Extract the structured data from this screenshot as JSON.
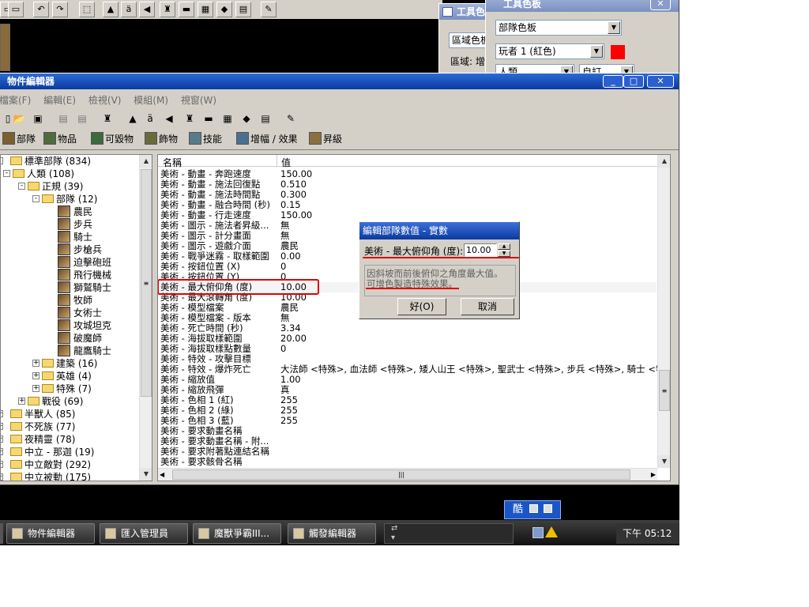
{
  "editor_window": {
    "title": "物件編輯器",
    "menu": [
      "檔案(F)",
      "編輯(E)",
      "檢視(V)",
      "模組(M)",
      "視窗(W)"
    ],
    "tabs": [
      {
        "label": "部隊",
        "icon": "unit-icon"
      },
      {
        "label": "物品",
        "icon": "item-icon"
      },
      {
        "label": "可毀物",
        "icon": "destructible-icon"
      },
      {
        "label": "飾物",
        "icon": "doodad-icon"
      },
      {
        "label": "技能",
        "icon": "ability-icon"
      },
      {
        "label": "增幅 / 效果",
        "icon": "buff-icon"
      },
      {
        "label": "昇級",
        "icon": "upgrade-icon"
      }
    ]
  },
  "tree": [
    {
      "label": "標準部隊 (834)",
      "kind": "folder",
      "depth": 0,
      "expander": "-"
    },
    {
      "label": "人類 (108)",
      "kind": "folder",
      "depth": 1,
      "expander": "-"
    },
    {
      "label": "正規 (39)",
      "kind": "folder",
      "depth": 2,
      "expander": "-"
    },
    {
      "label": "部隊 (12)",
      "kind": "folder",
      "depth": 3,
      "expander": "-"
    },
    {
      "label": "農民",
      "kind": "unit",
      "depth": 4
    },
    {
      "label": "步兵",
      "kind": "unit",
      "depth": 4
    },
    {
      "label": "騎士",
      "kind": "unit",
      "depth": 4
    },
    {
      "label": "步槍兵",
      "kind": "unit",
      "depth": 4
    },
    {
      "label": "迫擊砲班",
      "kind": "unit",
      "depth": 4
    },
    {
      "label": "飛行機械",
      "kind": "unit",
      "depth": 4
    },
    {
      "label": "獅鷲騎士",
      "kind": "unit",
      "depth": 4
    },
    {
      "label": "牧師",
      "kind": "unit",
      "depth": 4
    },
    {
      "label": "女術士",
      "kind": "unit",
      "depth": 4
    },
    {
      "label": "攻城坦克",
      "kind": "unit",
      "depth": 4
    },
    {
      "label": "破魔師",
      "kind": "unit",
      "depth": 4
    },
    {
      "label": "龍鷹騎士",
      "kind": "unit",
      "depth": 4
    },
    {
      "label": "建築 (16)",
      "kind": "folder",
      "depth": 3,
      "expander": "+"
    },
    {
      "label": "英雄 (4)",
      "kind": "folder",
      "depth": 3,
      "expander": "+"
    },
    {
      "label": "特殊 (7)",
      "kind": "folder",
      "depth": 3,
      "expander": "+"
    },
    {
      "label": "戰役 (69)",
      "kind": "folder",
      "depth": 2,
      "expander": "+"
    },
    {
      "label": "半獸人 (85)",
      "kind": "folder",
      "depth": 0,
      "expander": "+"
    },
    {
      "label": "不死族 (77)",
      "kind": "folder",
      "depth": 0,
      "expander": "+"
    },
    {
      "label": "夜精靈 (78)",
      "kind": "folder",
      "depth": 0,
      "expander": "+"
    },
    {
      "label": "中立 - 那迦 (19)",
      "kind": "folder",
      "depth": 0,
      "expander": "+"
    },
    {
      "label": "中立敵對 (292)",
      "kind": "folder",
      "depth": 0,
      "expander": "+"
    },
    {
      "label": "中立被動 (175)",
      "kind": "folder",
      "depth": 0,
      "expander": "+"
    }
  ],
  "grid": {
    "header_name": "名稱",
    "header_value": "值",
    "rows": [
      {
        "name": "美術 - 動畫 - 奔跑速度",
        "value": "150.00"
      },
      {
        "name": "美術 - 動畫 - 施法回復點",
        "value": "0.510"
      },
      {
        "name": "美術 - 動畫 - 施法時間點",
        "value": "0.300"
      },
      {
        "name": "美術 - 動畫 - 融合時間 (秒)",
        "value": "0.15"
      },
      {
        "name": "美術 - 動畫 - 行走速度",
        "value": "150.00"
      },
      {
        "name": "美術 - 圖示 - 施法者昇級...",
        "value": "無"
      },
      {
        "name": "美術 - 圖示 - 計分畫面",
        "value": "無"
      },
      {
        "name": "美術 - 圖示 - 遊戲介面",
        "value": "農民"
      },
      {
        "name": "美術 - 戰爭迷霧 - 取樣範圍",
        "value": "0.00"
      },
      {
        "name": "美術 - 按鈕位置 (X)",
        "value": "0"
      },
      {
        "name": "美術 - 按鈕位置 (Y)",
        "value": "0"
      },
      {
        "name": "美術 - 最大俯仰角 (度)",
        "value": "10.00",
        "selected": true
      },
      {
        "name": "美術 - 最大滾轉角 (度)",
        "value": "10.00"
      },
      {
        "name": "美術 - 模型檔案",
        "value": "農民"
      },
      {
        "name": "美術 - 模型檔案 - 版本",
        "value": "無"
      },
      {
        "name": "美術 - 死亡時間 (秒)",
        "value": "3.34"
      },
      {
        "name": "美術 - 海拔取樣範圍",
        "value": "20.00"
      },
      {
        "name": "美術 - 海拔取樣點數量",
        "value": "0"
      },
      {
        "name": "美術 - 特效 - 攻擊目標",
        "value": ""
      },
      {
        "name": "美術 - 特效 - 爆炸死亡",
        "value": "大法師 <特殊>, 血法師 <特殊>, 矮人山王 <特殊>, 聖武士 <特殊>, 步兵 <特殊>, 騎士 <特殊..."
      },
      {
        "name": "美術 - 縮放值",
        "value": "1.00"
      },
      {
        "name": "美術 - 縮放飛彈",
        "value": "真"
      },
      {
        "name": "美術 - 色相 1 (紅)",
        "value": "255"
      },
      {
        "name": "美術 - 色相 2 (綠)",
        "value": "255"
      },
      {
        "name": "美術 - 色相 3 (藍)",
        "value": "255"
      },
      {
        "name": "美術 - 要求動畫名稱",
        "value": ""
      },
      {
        "name": "美術 - 要求動畫名稱 - 附...",
        "value": ""
      },
      {
        "name": "美術 - 要求附著點連結名稱",
        "value": ""
      },
      {
        "name": "美術 - 要求骸骨名稱",
        "value": ""
      }
    ]
  },
  "dialog": {
    "title": "編輯部隊數值 - 實數",
    "field_label": "美術 - 最大俯仰角 (度):",
    "field_value": "10.00",
    "description_line1": "因斜坡而前後俯仰之角度最大值。",
    "description_line2": "可增色製造特殊效果。",
    "ok_label": "好(O)",
    "cancel_label": "取消"
  },
  "palette_window": {
    "title": "工具色板",
    "combo1": "部隊色板",
    "combo2": "玩者 1 (紅色)",
    "combo3": "人類",
    "combo4": "自訂",
    "player_color": "#ff0000"
  },
  "tools_window": {
    "title": "工具色",
    "combo": "區域色板",
    "label": "區域: 增"
  },
  "language_bar": {
    "label": "酷"
  },
  "taskbar": {
    "items": [
      "物件編輯器",
      "匯入管理員",
      "魔獸爭霸III...",
      "觸發編輯器"
    ],
    "clock": "下午 05:12"
  },
  "colors": {
    "title_active": "#0a3a9f",
    "window_face": "#d4d0c8",
    "annotation_red": "#e00000"
  }
}
